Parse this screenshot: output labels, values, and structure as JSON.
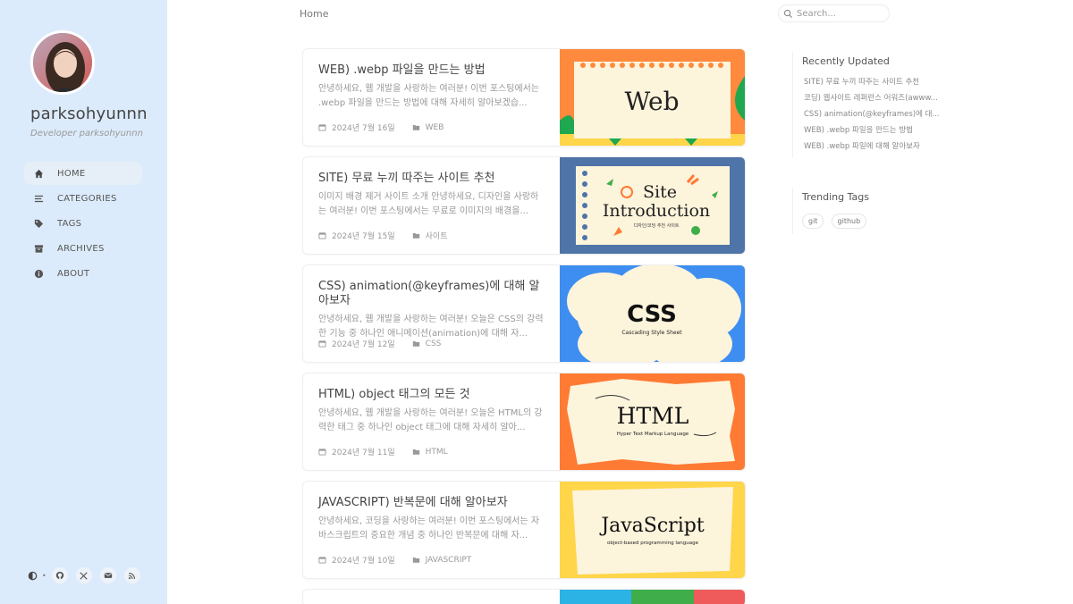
{
  "sidebar": {
    "title": "parksohyunnn",
    "subtitle": "Developer parksohyunnn",
    "nav": [
      {
        "label": "HOME",
        "icon": "home-icon"
      },
      {
        "label": "CATEGORIES",
        "icon": "list-icon"
      },
      {
        "label": "TAGS",
        "icon": "tags-icon"
      },
      {
        "label": "ARCHIVES",
        "icon": "archive-icon"
      },
      {
        "label": "ABOUT",
        "icon": "info-icon"
      }
    ],
    "bottom_icons": [
      "theme-toggle-icon",
      "github-icon",
      "x-twitter-icon",
      "email-icon",
      "rss-icon"
    ]
  },
  "topbar": {
    "breadcrumb": "Home",
    "search_placeholder": "Search..."
  },
  "posts": [
    {
      "title": "WEB) .webp 파일을 만드는 방법",
      "excerpt": "안녕하세요, 웹 개발을 사랑하는 여러분! 이번 포스팅에서는 .webp 파일을 만드는 방법에 대해 자세히 알아보겠습...",
      "date": "2024년 7월 16일",
      "category": "WEB",
      "thumb_text": "Web"
    },
    {
      "title": "SITE) 무료 누끼 따주는 사이트 추천",
      "excerpt": "이미지 배경 제거 사이트 소개 안녕하세요, 디자인을 사랑하는 여러분! 이번 포스팅에서는 무료로 이미지의 배경을...",
      "date": "2024년 7월 15일",
      "category": "사이트",
      "thumb_text": "Site",
      "thumb_text2": "Introduction",
      "thumb_sub": "디자인/코딩 추천 사이트"
    },
    {
      "title": "CSS) animation(@keyframes)에 대해 알아보자",
      "excerpt": "안녕하세요, 웹 개발을 사랑하는 여러분! 오늘은 CSS의 강력한 기능 중 하나인 애니메이션(animation)에 대해 자...",
      "date": "2024년 7월 12일",
      "category": "CSS",
      "thumb_text": "CSS",
      "thumb_sub": "Cascading Style Sheet"
    },
    {
      "title": "HTML) object 태그의 모든 것",
      "excerpt": "안녕하세요, 웹 개발을 사랑하는 여러분! 오늘은 HTML의 강력한 태그 중 하나인 object 태그에 대해 자세히 알아...",
      "date": "2024년 7월 11일",
      "category": "HTML",
      "thumb_text": "HTML",
      "thumb_sub": "Hyper Text Markup Language"
    },
    {
      "title": "JAVASCRIPT) 반복문에 대해 알아보자",
      "excerpt": "안녕하세요, 코딩을 사랑하는 여러분! 이번 포스팅에서는 자바스크립트의 중요한 개념 중 하나인 반복문에 대해 자...",
      "date": "2024년 7월 10일",
      "category": "JAVASCRIPT",
      "thumb_text": "JavaScript",
      "thumb_sub": "object-based programming language"
    }
  ],
  "recently_updated": {
    "heading": "Recently Updated",
    "items": [
      "SITE) 무료 누끼 따주는 사이트 추천",
      "코딩) 웹사이트 레퍼런스 어워즈(awww...",
      "CSS) animation(@keyframes)에 대...",
      "WEB) .webp 파일을 만드는 방법",
      "WEB) .webp 파일에 대해 알아보자"
    ]
  },
  "trending_tags": {
    "heading": "Trending Tags",
    "tags": [
      "git",
      "github"
    ]
  },
  "colors": {
    "sidebar_bg": "#dcebfb",
    "web_thumb": "#ff8a3d",
    "site_thumb": "#4f74a8",
    "css_thumb": "#3d8ef0",
    "html_thumb": "#ff7a33",
    "js_thumb": "#ffd54a"
  }
}
